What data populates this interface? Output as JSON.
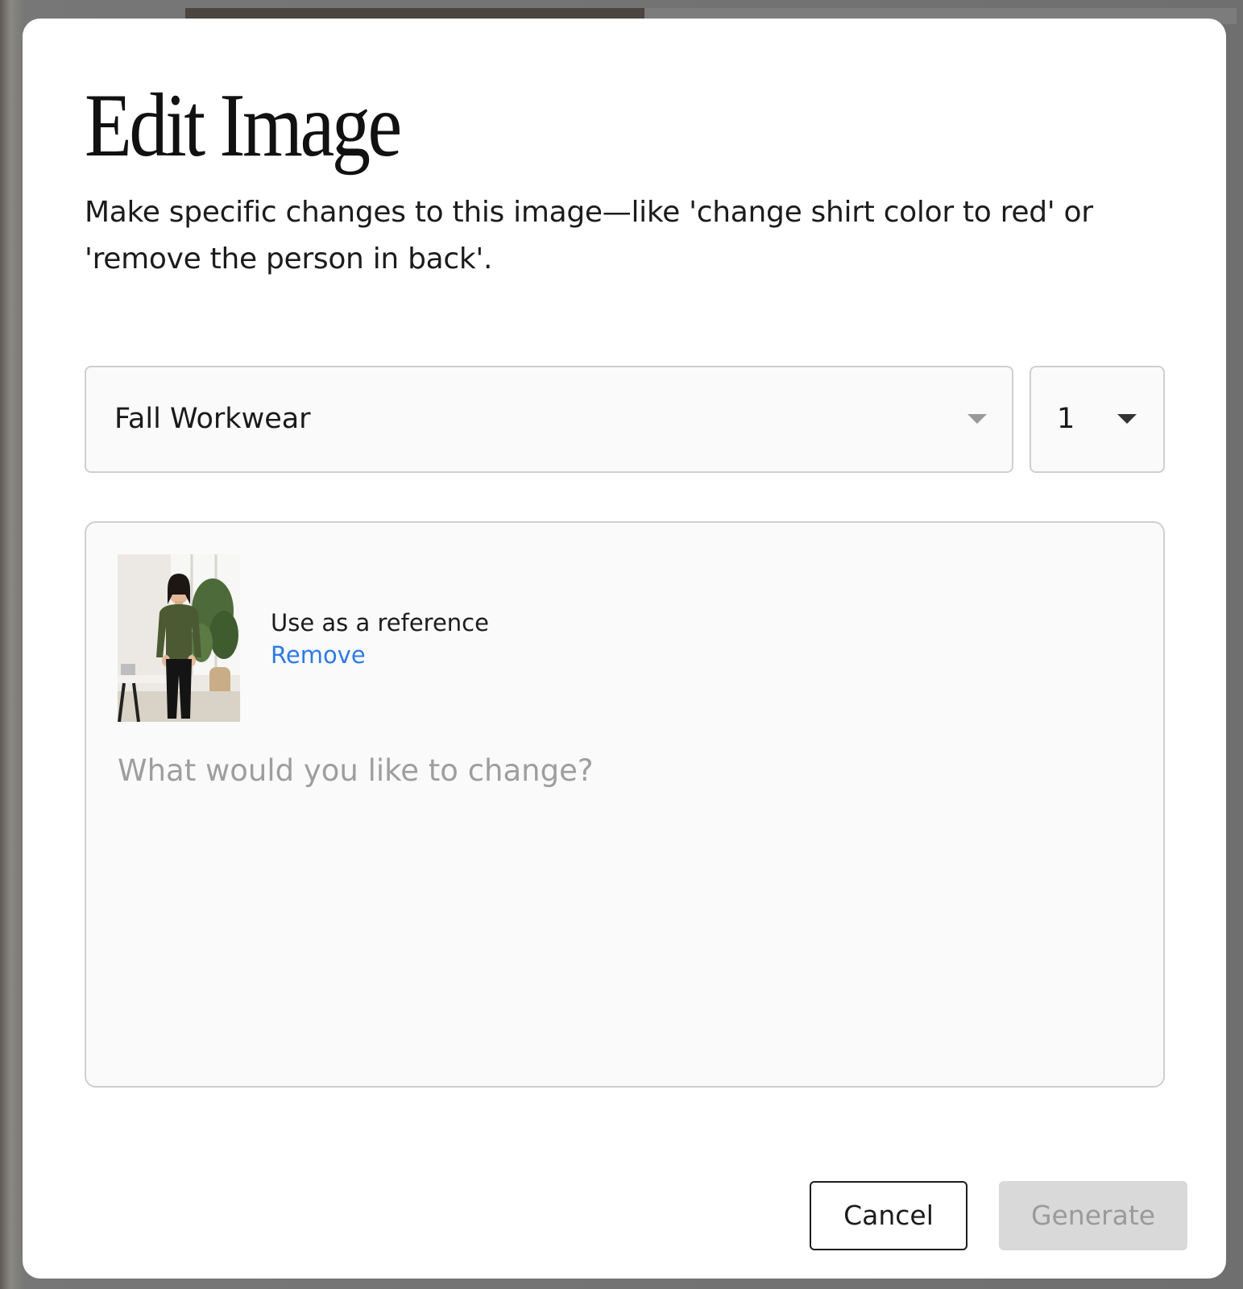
{
  "modal": {
    "title": "Edit Image",
    "description": "Make specific changes to this image—like 'change shirt color to red' or 'remove the person in back'."
  },
  "collection_select": {
    "selected": "Fall Workwear",
    "icon": "chevron-down-icon"
  },
  "count_select": {
    "selected": "1",
    "icon": "chevron-down-icon"
  },
  "reference": {
    "label": "Use as a reference",
    "remove_label": "Remove",
    "thumbnail_alt": "woman in olive sweater and black trousers in office"
  },
  "prompt": {
    "value": "",
    "placeholder": "What would you like to change?"
  },
  "actions": {
    "cancel_label": "Cancel",
    "generate_label": "Generate",
    "generate_disabled": true
  },
  "colors": {
    "link": "#2f7ae5",
    "disabled_bg": "#d9d9d9",
    "disabled_text": "#9a9a9a",
    "border": "#cfcfcf"
  }
}
